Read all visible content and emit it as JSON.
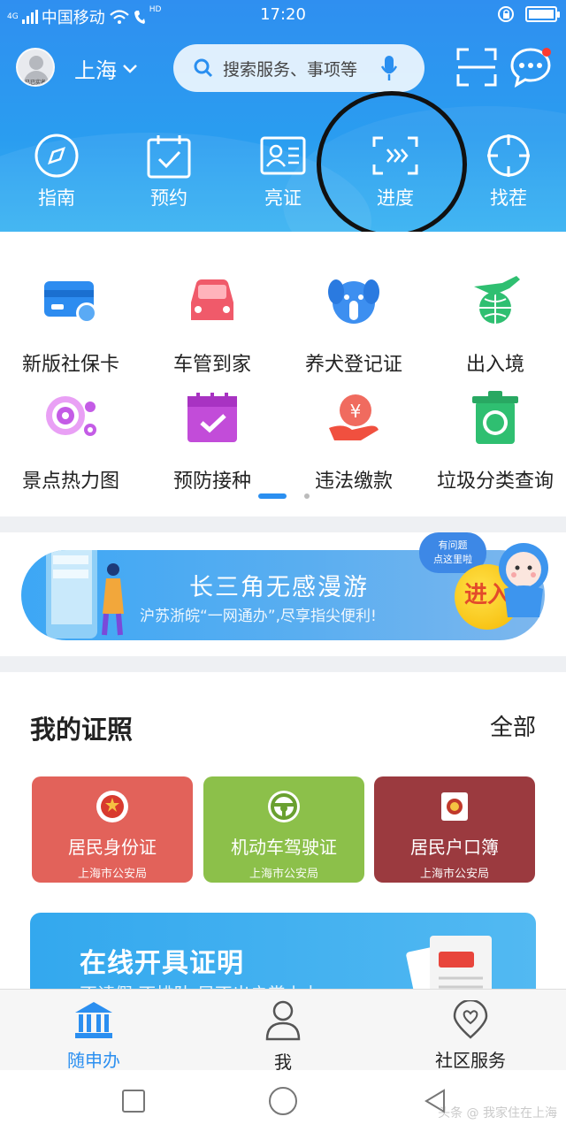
{
  "status_bar": {
    "carrier": "中国移动",
    "network": "4G",
    "hd": "HD",
    "time": "17:20"
  },
  "header": {
    "city": "上海",
    "search_placeholder": "搜索服务、事项等",
    "avatar_label": "已已实名"
  },
  "quick_tools": [
    {
      "label": "指南",
      "icon": "compass-icon"
    },
    {
      "label": "预约",
      "icon": "calendar-check-icon"
    },
    {
      "label": "亮证",
      "icon": "id-card-icon"
    },
    {
      "label": "进度",
      "icon": "progress-icon"
    },
    {
      "label": "找茬",
      "icon": "target-icon"
    }
  ],
  "services": [
    {
      "label": "新版社保卡",
      "icon": "social-security-card-icon",
      "color": "#2d8cf0"
    },
    {
      "label": "车管到家",
      "icon": "car-icon",
      "color": "#f05a6a"
    },
    {
      "label": "养犬登记证",
      "icon": "dog-icon",
      "color": "#3d8ff0"
    },
    {
      "label": "出入境",
      "icon": "airplane-globe-icon",
      "color": "#2fbf71"
    },
    {
      "label": "景点热力图",
      "icon": "heatmap-icon",
      "color": "#c45ce6"
    },
    {
      "label": "预防接种",
      "icon": "calendar-vaccine-icon",
      "color": "#c24cd9"
    },
    {
      "label": "违法缴款",
      "icon": "yuan-hand-icon",
      "color": "#f0503f"
    },
    {
      "label": "垃圾分类查询",
      "icon": "trash-globe-icon",
      "color": "#2fbf71"
    }
  ],
  "banner": {
    "title": "长三角无感漫游",
    "subtitle": "沪苏浙皖“一网通办”,尽享指尖便利!",
    "bubble_line1": "有问题",
    "bubble_line2": "点这里啦",
    "enter_label": "进入"
  },
  "certificates": {
    "title": "我的证照",
    "all_label": "全部",
    "items": [
      {
        "name": "居民身份证",
        "issuer": "上海市公安局",
        "color": "#e2625a"
      },
      {
        "name": "机动车驾驶证",
        "issuer": "上海市公安局",
        "color": "#8cc04a"
      },
      {
        "name": "居民户口簿",
        "issuer": "上海市公安局",
        "color": "#9b3a3f"
      }
    ]
  },
  "promo": {
    "title": "在线开具证明",
    "subtitle": "不请假 不排队 足不出户掌上办"
  },
  "bottom_nav": [
    {
      "label": "随申办",
      "icon": "government-building-icon",
      "active": true
    },
    {
      "label": "我",
      "icon": "person-icon",
      "active": false
    },
    {
      "label": "社区服务",
      "icon": "heart-location-icon",
      "active": false
    }
  ],
  "watermark": "头条 @ 我家住在上海"
}
